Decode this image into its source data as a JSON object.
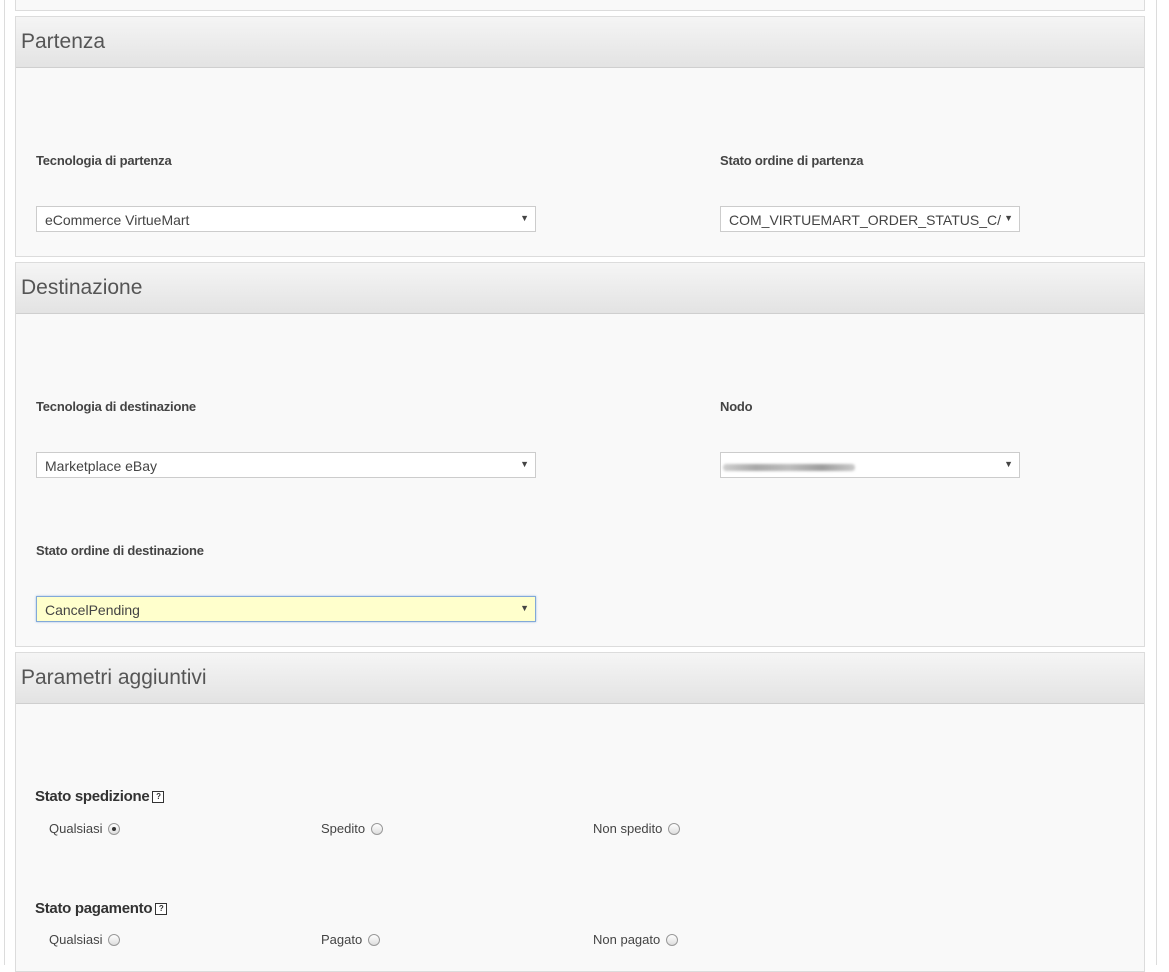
{
  "partenza": {
    "title": "Partenza",
    "tech_label": "Tecnologia di partenza",
    "tech_value": "eCommerce VirtueMart",
    "status_label": "Stato ordine di partenza",
    "status_value": "COM_VIRTUEMART_ORDER_STATUS_C/"
  },
  "destinazione": {
    "title": "Destinazione",
    "tech_label": "Tecnologia di destinazione",
    "tech_value": "Marketplace eBay",
    "node_label": "Nodo",
    "status_label": "Stato ordine di destinazione",
    "status_value": "CancelPending"
  },
  "parametri": {
    "title": "Parametri aggiuntivi",
    "shipping": {
      "label": "Stato spedizione",
      "options": [
        "Qualsiasi",
        "Spedito",
        "Non spedito"
      ],
      "selected": "Qualsiasi"
    },
    "payment": {
      "label": "Stato pagamento",
      "options": [
        "Qualsiasi",
        "Pagato",
        "Non pagato"
      ],
      "selected": null
    }
  },
  "icons": {
    "help": "?",
    "dropdown": "▼"
  }
}
